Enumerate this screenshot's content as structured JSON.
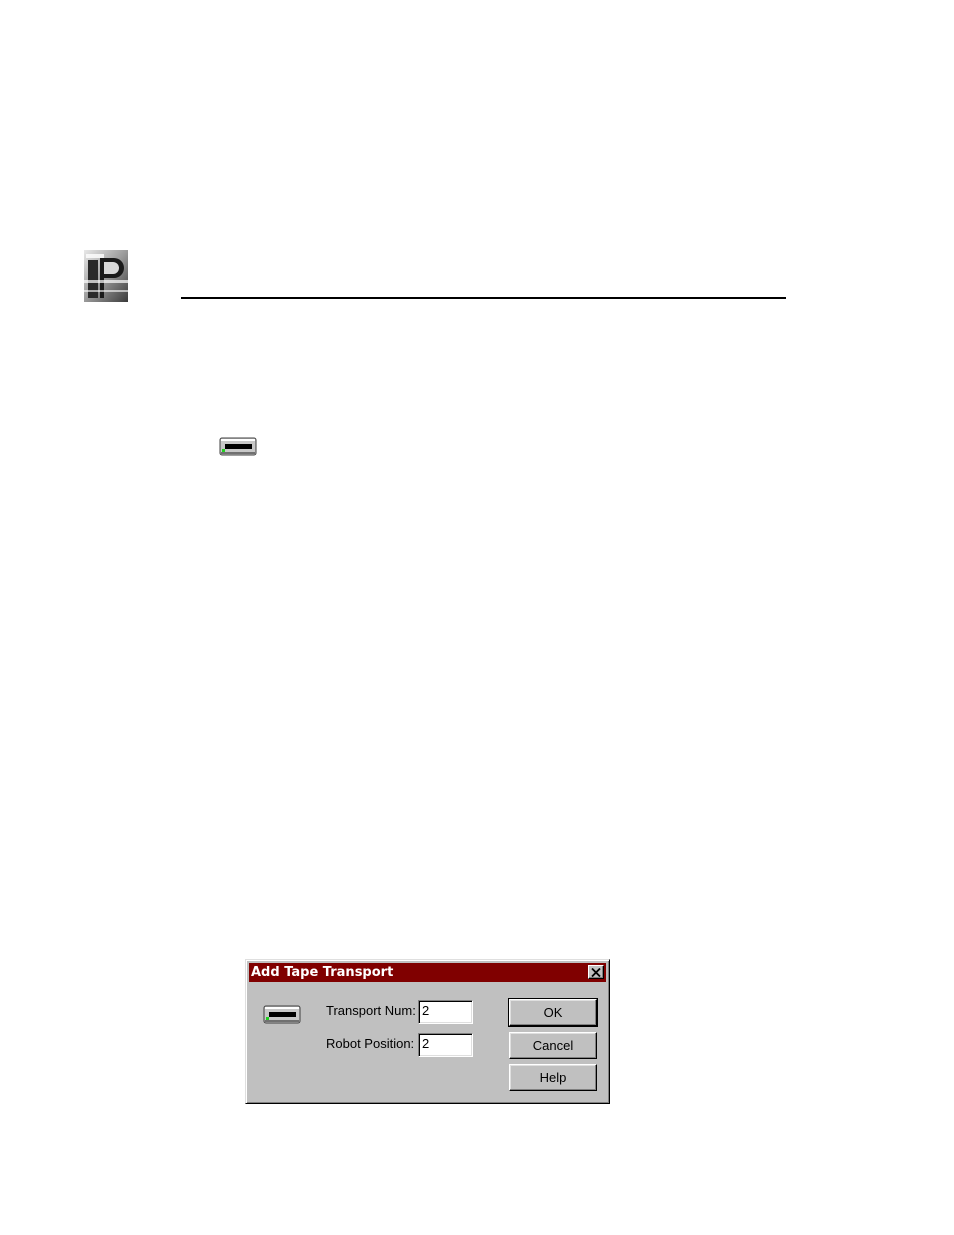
{
  "header": {
    "logo_icon": "profile-logo-icon"
  },
  "body": {
    "inline_icon": "tape-transport-icon"
  },
  "dialog": {
    "title": "Add Tape Transport",
    "title_bar_color": "#800000",
    "close_icon": "close-icon",
    "icon": "tape-transport-icon",
    "fields": [
      {
        "label": "Transport Num:",
        "value": "2"
      },
      {
        "label": "Robot Position:",
        "value": "2"
      }
    ],
    "buttons": {
      "ok": "OK",
      "cancel": "Cancel",
      "help": "Help"
    }
  }
}
